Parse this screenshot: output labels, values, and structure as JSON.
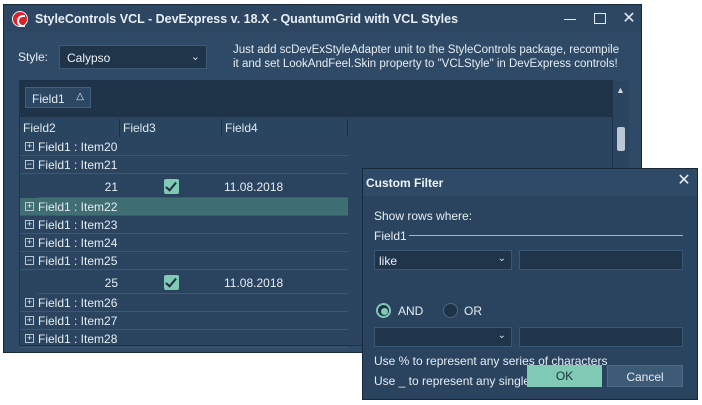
{
  "window": {
    "title": "StyleControls VCL - DevExpress v. 18.X - QuantumGrid with VCL Styles",
    "minimize_icon": "minimize-icon",
    "maximize_icon": "maximize-icon",
    "close_glyph": "✕"
  },
  "style_picker": {
    "label": "Style:",
    "value": "Calypso"
  },
  "info": {
    "line1": "Just add scDevExStyleAdapter unit to the StyleControls package, recompile",
    "line2": "it and set LookAndFeel.Skin property to \"VCLStyle\" in DevExpress controls!"
  },
  "grid": {
    "group_by": {
      "field": "Field1",
      "sort_glyph": "△"
    },
    "columns": [
      "Field2",
      "Field3",
      "Field4"
    ],
    "rows": [
      {
        "kind": "group",
        "expander": "+",
        "text": "Field1 : Item20"
      },
      {
        "kind": "group",
        "expander": "−",
        "text": "Field1 : Item21"
      },
      {
        "kind": "data",
        "number": "21",
        "checked": true,
        "date": "11.08.2018"
      },
      {
        "kind": "group",
        "expander": "+",
        "text": "Field1 : Item22",
        "selected": true
      },
      {
        "kind": "group",
        "expander": "+",
        "text": "Field1 : Item23"
      },
      {
        "kind": "group",
        "expander": "+",
        "text": "Field1 : Item24"
      },
      {
        "kind": "group",
        "expander": "−",
        "text": "Field1 : Item25"
      },
      {
        "kind": "data",
        "number": "25",
        "checked": true,
        "date": "11.08.2018"
      },
      {
        "kind": "group",
        "expander": "+",
        "text": "Field1 : Item26"
      },
      {
        "kind": "group",
        "expander": "+",
        "text": "Field1 : Item27"
      },
      {
        "kind": "group",
        "expander": "+",
        "text": "Field1 : Item28"
      }
    ],
    "scroll_up_glyph": "▲"
  },
  "dialog": {
    "title": "Custom Filter",
    "close_glyph": "✕",
    "show_rows": "Show rows where:",
    "field": "Field1",
    "operator1": "like",
    "value1": "",
    "radio_and": "AND",
    "radio_or": "OR",
    "selected_radio": "AND",
    "operator2": "",
    "value2": "",
    "hint1": "Use % to represent any series of characters",
    "hint2": "Use _ to represent any single character",
    "ok_label": "OK",
    "cancel_label": "Cancel"
  },
  "colors": {
    "window_bg": "#2f4a66",
    "accent": "#7fc9b5",
    "selected_row": "#3f6e73"
  }
}
